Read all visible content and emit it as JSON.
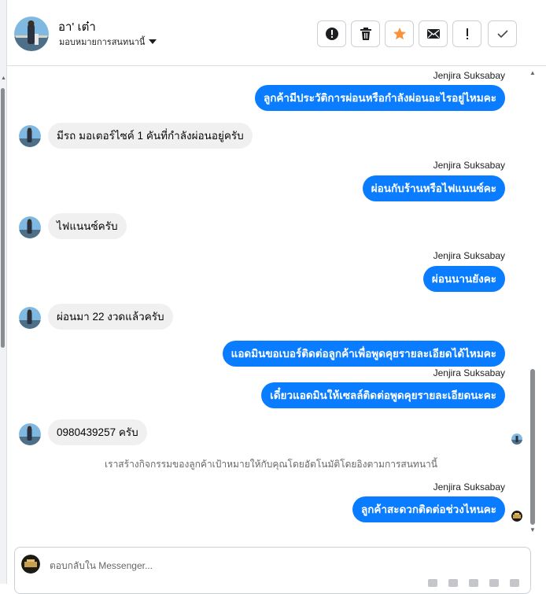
{
  "header": {
    "name": "อา' เต๋า",
    "assign_label": "มอบหมายการสนทนานี้"
  },
  "toolbar": {
    "icons": [
      "alert-circle-icon",
      "trash-icon",
      "star-icon",
      "envelope-icon",
      "exclamation-icon",
      "check-icon"
    ],
    "star_color": "#f7923a"
  },
  "messages": [
    {
      "sender": "Jenjira Suksabay",
      "text": "ลูกค้ามีประวัติการผ่อนหรือกำลังผ่อนอะไรอยู่ไหมคะ"
    },
    {
      "text": "มีรถ มอเตอร์ไซค์ 1 คันที่กำลังผ่อนอยู่ครับ"
    },
    {
      "sender": "Jenjira Suksabay",
      "text": "ผ่อนกับร้านหรือไฟแนนซ์คะ"
    },
    {
      "text": "ไฟแนนซ์ครับ"
    },
    {
      "sender": "Jenjira Suksabay",
      "text": "ผ่อนนานยังคะ"
    },
    {
      "text": "ผ่อนมา 22 งวดแล้วครับ"
    },
    {
      "text": "แอดมินขอเบอร์ติดต่อลูกค้าเพื่อพูดคุยรายละเอียดได้ไหมคะ"
    },
    {
      "sender": "Jenjira Suksabay",
      "text": "เดี๋ยวแอดมินให้เซลล์ติดต่อพูดคุยรายละเอียดนะคะ"
    },
    {
      "text": "0980439257 ครับ"
    },
    {
      "text": "เราสร้างกิจกรรมของลูกค้าเป้าหมายให้กับคุณโดยอัตโนมัติโดยอิงตามการสนทนานี้"
    },
    {
      "sender": "Jenjira Suksabay",
      "text": "ลูกค้าสะดวกติดต่อช่วงไหนคะ"
    }
  ],
  "composer": {
    "placeholder": "ตอบกลับใน Messenger..."
  },
  "colors": {
    "outgoing_bubble": "#0a7cff",
    "incoming_bubble": "#f0f0f0"
  }
}
